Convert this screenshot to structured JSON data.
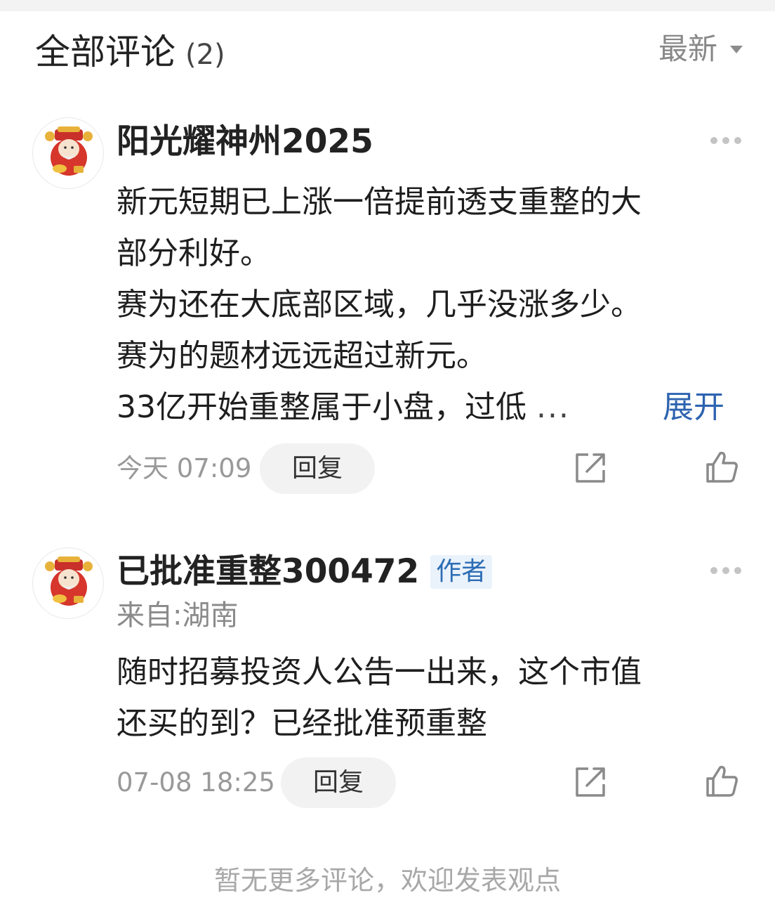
{
  "header": {
    "title": "全部评论",
    "count": "(2)",
    "sort_label": "最新"
  },
  "comments": [
    {
      "author": "阳光耀神州2025",
      "lines": [
        "新元短期已上涨一倍提前透支重整的大",
        "部分利好。",
        "赛为还在大底部区域，几乎没涨多少。",
        "赛为的题材远远超过新元。",
        "33亿开始重整属于小盘，过低"
      ],
      "ellipsis": "...",
      "expand_label": "展开",
      "time": "今天 07:09",
      "reply_label": "回复"
    },
    {
      "author": "已批准重整300472",
      "badge": "作者",
      "location": "来自:湖南",
      "lines": [
        "随时招募投资人公告一出来，这个市值",
        "还买的到？已经批准预重整"
      ],
      "time": "07-08 18:25",
      "reply_label": "回复"
    }
  ],
  "footer_text": "暂无更多评论，欢迎发表观点",
  "colors": {
    "link": "#2d63b0",
    "badge_bg": "#eaf2fb",
    "badge_text": "#2d6db5",
    "muted": "#999999"
  },
  "icons": [
    "more-dots-icon",
    "share-icon",
    "thumbs-up-icon",
    "sort-caret-icon",
    "avatar-caishen-icon"
  ]
}
